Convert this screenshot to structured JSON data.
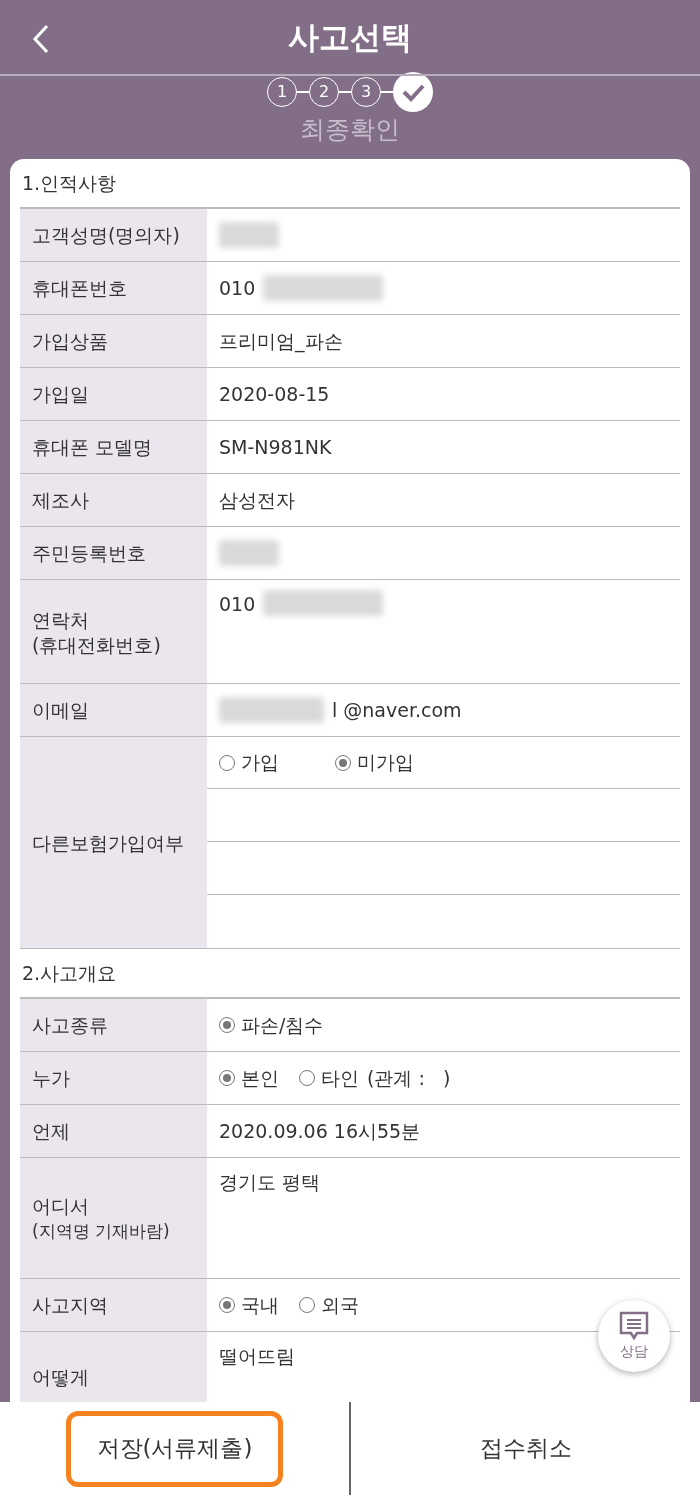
{
  "header": {
    "title": "사고선택"
  },
  "steps": [
    {
      "kind": "number",
      "label": "1"
    },
    {
      "kind": "number",
      "label": "2"
    },
    {
      "kind": "number",
      "label": "3"
    },
    {
      "kind": "check"
    }
  ],
  "step_caption": "최종확인",
  "sections": [
    {
      "title": "1.인적사항",
      "rows": [
        {
          "label": "고객성명(명의자)",
          "kind": "redacted"
        },
        {
          "label": "휴대폰번호",
          "kind": "text",
          "value": "010",
          "blur_after": true
        },
        {
          "label": "가입상품",
          "kind": "text",
          "value": "프리미엄_파손"
        },
        {
          "label": "가입일",
          "kind": "text",
          "value": "2020-08-15"
        },
        {
          "label": "휴대폰 모델명",
          "kind": "text",
          "value": "SM-N981NK"
        },
        {
          "label": "제조사",
          "kind": "text",
          "value": "삼성전자"
        },
        {
          "label": "주민등록번호",
          "kind": "redacted"
        },
        {
          "label": "연락처",
          "sublabel": "(휴대전화번호)",
          "kind": "text",
          "value": "010",
          "blur_after": true
        },
        {
          "label": "이메일",
          "kind": "text",
          "value": "l @naver.com",
          "blur_before": true
        },
        {
          "label": "다른보험가입여부",
          "kind": "radio-lines",
          "options": [
            {
              "label": "가입",
              "selected": false
            },
            {
              "label": "미가입",
              "selected": true
            }
          ]
        }
      ]
    },
    {
      "title": "2.사고개요",
      "rows": [
        {
          "label": "사고종류",
          "kind": "radio",
          "options": [
            {
              "label": "파손/침수",
              "selected": true
            }
          ]
        },
        {
          "label": "누가",
          "kind": "radio",
          "options": [
            {
              "label": "본인",
              "selected": true
            },
            {
              "label": "타인",
              "selected": false
            }
          ],
          "note": "(관계 :   )"
        },
        {
          "label": "언제",
          "kind": "text",
          "value": "2020.09.06 16시55분"
        },
        {
          "label": "어디서",
          "sublabel": "(지역명 기재바람)",
          "kind": "text",
          "value": "경기도 평택"
        },
        {
          "label": "사고지역",
          "kind": "radio",
          "options": [
            {
              "label": "국내",
              "selected": true
            },
            {
              "label": "외국",
              "selected": false
            }
          ]
        },
        {
          "label": "어떻게",
          "kind": "text",
          "value": "떨어뜨림"
        }
      ]
    }
  ],
  "consult_button": {
    "label": "상담"
  },
  "bottom_buttons": [
    {
      "label": "저장(서류제출)",
      "focused": true
    },
    {
      "label": "접수취소",
      "focused": false
    }
  ]
}
